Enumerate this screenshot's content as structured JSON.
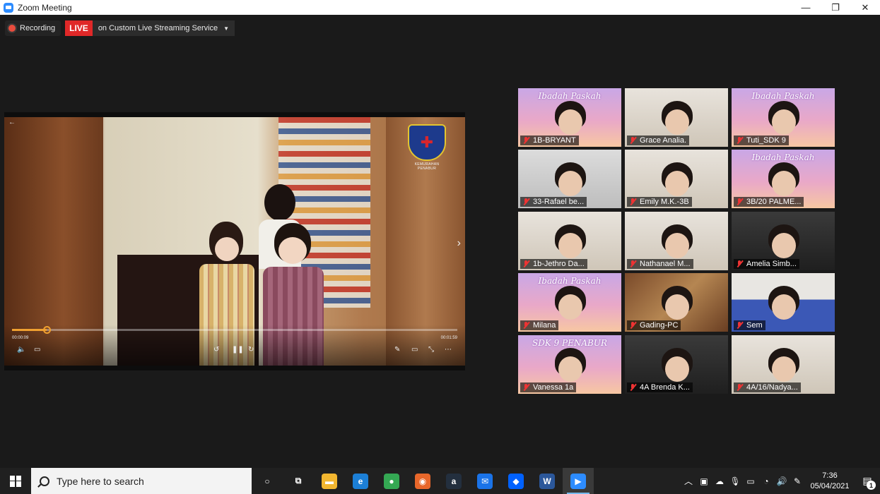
{
  "window": {
    "title": "Zoom Meeting",
    "controls": {
      "minimize": "—",
      "restore": "❐",
      "close": "✕"
    }
  },
  "recording": {
    "label": "Recording",
    "live_badge": "LIVE",
    "stream_target": "on Custom Live Streaming Service"
  },
  "share": {
    "logo_caption": "KEMURAHAN PENABUR",
    "current_time": "00:00:09",
    "duration": "00:01:59",
    "progress": 0.077,
    "controls": [
      "volume-icon",
      "subtitles-icon",
      "rewind-icon",
      "pause-icon",
      "forward-icon",
      "pen-icon",
      "screen-icon",
      "exit-fullscreen-icon",
      "more-icon"
    ]
  },
  "gallery": {
    "tiles": [
      {
        "name": "1B-BRYANT",
        "bg": "paskah",
        "banner": "Ibadah Paskah"
      },
      {
        "name": "Grace Analia.",
        "bg": "room",
        "banner": ""
      },
      {
        "name": "Tuti_SDK 9",
        "bg": "paskah",
        "banner": "Ibadah Paskah"
      },
      {
        "name": "33-Rafael be...",
        "bg": "wall",
        "banner": ""
      },
      {
        "name": "Emily M.K.-3B",
        "bg": "room",
        "banner": ""
      },
      {
        "name": "3B/20 PALME...",
        "bg": "paskah",
        "banner": "Ibadah Paskah"
      },
      {
        "name": "1b-Jethro Da...",
        "bg": "room",
        "banner": ""
      },
      {
        "name": "Nathanael M...",
        "bg": "room",
        "banner": ""
      },
      {
        "name": "Amelia Simb...",
        "bg": "dark",
        "banner": ""
      },
      {
        "name": "Milana",
        "bg": "paskah",
        "banner": "Ibadah Paskah"
      },
      {
        "name": "Gading-PC",
        "bg": "brown",
        "banner": ""
      },
      {
        "name": "Sem",
        "bg": "blue",
        "banner": ""
      },
      {
        "name": "Vanessa 1a",
        "bg": "paskah",
        "banner": "SDK 9 PENABUR"
      },
      {
        "name": "4A Brenda K...",
        "bg": "dark",
        "banner": ""
      },
      {
        "name": "4A/16/Nadya...",
        "bg": "room",
        "banner": ""
      }
    ]
  },
  "taskbar": {
    "search_placeholder": "Type here to search",
    "apps": [
      {
        "icon": "cortana-icon",
        "glyph": "○",
        "color": "transparent"
      },
      {
        "icon": "task-view-icon",
        "glyph": "⧉",
        "color": "transparent"
      },
      {
        "icon": "file-explorer-icon",
        "glyph": "▬",
        "color": "#f2b630"
      },
      {
        "icon": "edge-icon",
        "glyph": "e",
        "color": "#1c7fd6"
      },
      {
        "icon": "chrome-icon",
        "glyph": "●",
        "color": "#34a853"
      },
      {
        "icon": "firefox-icon",
        "glyph": "◉",
        "color": "#e8672a"
      },
      {
        "icon": "amazon-icon",
        "glyph": "a",
        "color": "#232f3e"
      },
      {
        "icon": "mail-icon",
        "glyph": "✉",
        "color": "#1a73e8"
      },
      {
        "icon": "dropbox-icon",
        "glyph": "◆",
        "color": "#0061fe"
      },
      {
        "icon": "word-icon",
        "glyph": "W",
        "color": "#2b579a"
      },
      {
        "icon": "zoom-icon",
        "glyph": "▶",
        "color": "#2d8cff",
        "active": true
      }
    ],
    "clock_time": "7:36",
    "clock_date": "05/04/2021",
    "notification_count": "1"
  }
}
